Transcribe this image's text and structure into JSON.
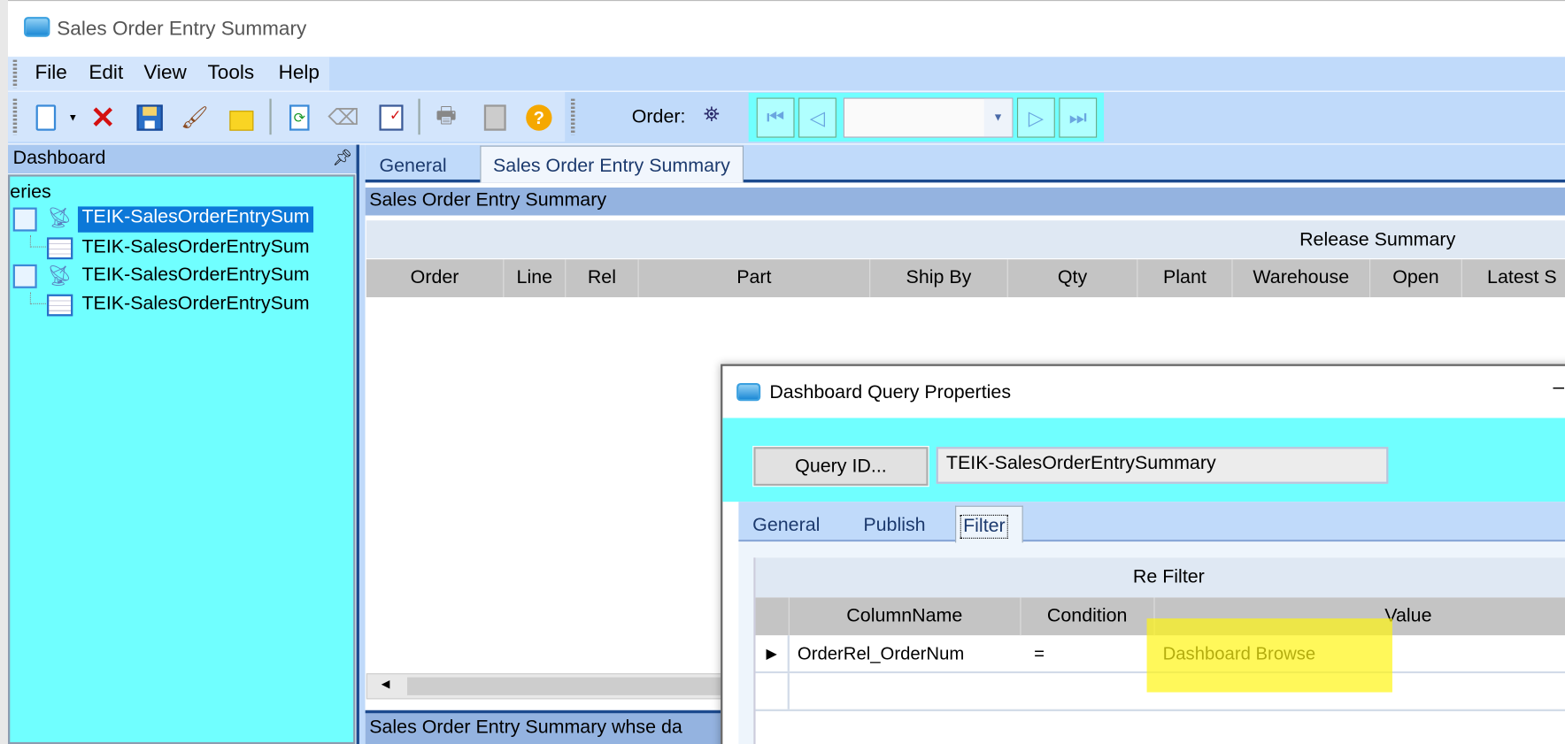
{
  "window": {
    "title": "Sales Order Entry Summary"
  },
  "menu": [
    "File",
    "Edit",
    "View",
    "Tools",
    "Help"
  ],
  "toolbar": {
    "icons": [
      "new-icon",
      "dropdown-arrow-icon",
      "delete-icon",
      "save-icon",
      "clear-icon",
      "memo-icon",
      "refresh-icon",
      "eraser-icon",
      "checklist-icon",
      "print-icon",
      "print-preview-icon",
      "help-icon"
    ],
    "order_label": "Order:",
    "order_value": ""
  },
  "dock": {
    "title": "Dashboard",
    "tree": {
      "root_label": "eries",
      "items": [
        {
          "label": "TEIK-SalesOrderEntrySum",
          "type": "query",
          "selected": true
        },
        {
          "label": "TEIK-SalesOrderEntrySum",
          "type": "grid"
        },
        {
          "label": "TEIK-SalesOrderEntrySum",
          "type": "query"
        },
        {
          "label": "TEIK-SalesOrderEntrySum",
          "type": "grid"
        }
      ]
    }
  },
  "main": {
    "tabs": [
      {
        "label": "General"
      },
      {
        "label": "Sales Order Entry Summary",
        "active": true
      }
    ],
    "panel_title": "Sales Order Entry Summary",
    "grid_band": "Release Summary",
    "columns": [
      "Order",
      "Line",
      "Rel",
      "Part",
      "Ship By",
      "Qty",
      "Plant",
      "Warehouse",
      "Open",
      "Latest S"
    ],
    "bottom_panel_title": "Sales Order Entry Summary whse da"
  },
  "dialog": {
    "title": "Dashboard Query Properties",
    "query_id_button": "Query ID...",
    "query_id_value": "TEIK-SalesOrderEntrySummary",
    "tabs": [
      {
        "label": "General"
      },
      {
        "label": "Publish"
      },
      {
        "label": "Filter",
        "active": true
      }
    ],
    "filter": {
      "band": "Re Filter",
      "columns": [
        "ColumnName",
        "Condition",
        "Value"
      ],
      "rows": [
        {
          "column": "OrderRel_OrderNum",
          "condition": "=",
          "value": "Dashboard Browse"
        }
      ]
    },
    "highlight_color": "#ffff33"
  }
}
